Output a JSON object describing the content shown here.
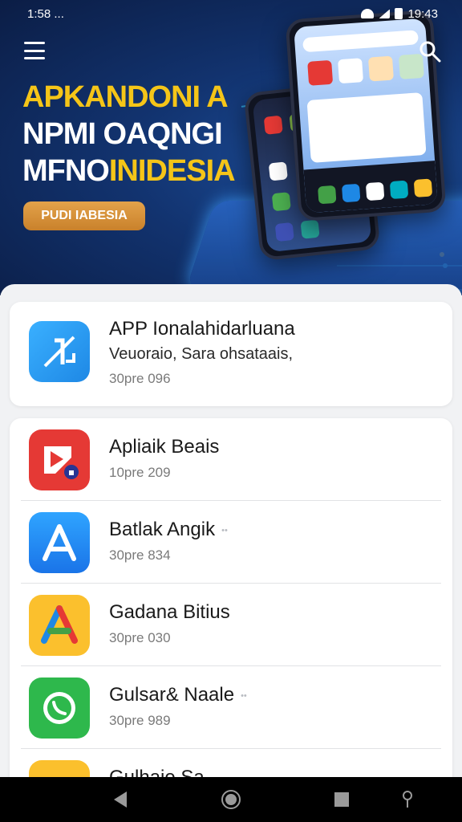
{
  "status": {
    "left_text": "1:58 ...",
    "right_text": "19:43"
  },
  "hero": {
    "title_line1": "APKANDONI A",
    "title_line2": "NPMI OAQNGI",
    "title_line3a": "MFNO",
    "title_line3b": "INIDESIA",
    "cta_label": "PUDI IABESIA"
  },
  "featured": {
    "name": "APP Ionalahidarluana",
    "subtitle": "Veuoraio, Sara ohsataais,",
    "meta": "30pre 096"
  },
  "apps": [
    {
      "name": "Apliaik Beais",
      "meta": "10pre 209",
      "tag": ""
    },
    {
      "name": "Batlak Angik",
      "meta": "30pre 834",
      "tag": "••"
    },
    {
      "name": "Gadana Bitius",
      "meta": "30pre 030",
      "tag": ""
    },
    {
      "name": "Gulsar& Naale",
      "meta": "30pre 989",
      "tag": "••"
    },
    {
      "name": "Gulhaie Sa",
      "meta": "",
      "tag": ""
    }
  ],
  "colors": {
    "accent": "#f5c518",
    "hero_bg": "#12336f",
    "cta": "#d38f38"
  }
}
